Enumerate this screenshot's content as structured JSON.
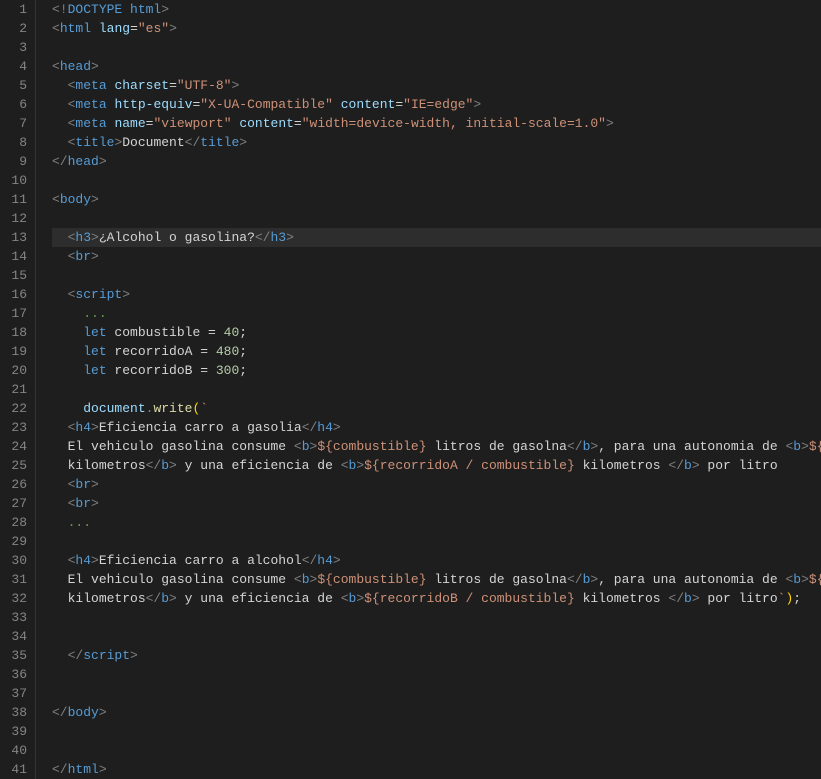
{
  "editor": {
    "background": "#1e1e1e",
    "lines": [
      {
        "num": 1,
        "tokens": [
          {
            "t": "<!",
            "c": "punct"
          },
          {
            "t": "DOCTYPE",
            "c": "kw"
          },
          {
            "t": " html",
            "c": "tag"
          },
          {
            "t": ">",
            "c": "punct"
          }
        ]
      },
      {
        "num": 2,
        "tokens": [
          {
            "t": "<",
            "c": "punct"
          },
          {
            "t": "html",
            "c": "tag"
          },
          {
            "t": " ",
            "c": "text-white"
          },
          {
            "t": "lang",
            "c": "attr"
          },
          {
            "t": "=",
            "c": "equals"
          },
          {
            "t": "\"es\"",
            "c": "str"
          },
          {
            "t": ">",
            "c": "punct"
          }
        ]
      },
      {
        "num": 3,
        "tokens": []
      },
      {
        "num": 4,
        "tokens": [
          {
            "t": "<",
            "c": "punct"
          },
          {
            "t": "head",
            "c": "tag"
          },
          {
            "t": ">",
            "c": "punct"
          }
        ]
      },
      {
        "num": 5,
        "tokens": [
          {
            "t": "  ",
            "c": "text-white"
          },
          {
            "t": "<",
            "c": "punct"
          },
          {
            "t": "meta",
            "c": "tag"
          },
          {
            "t": " ",
            "c": "text-white"
          },
          {
            "t": "charset",
            "c": "attr"
          },
          {
            "t": "=",
            "c": "equals"
          },
          {
            "t": "\"UTF-8\"",
            "c": "str"
          },
          {
            "t": ">",
            "c": "punct"
          }
        ]
      },
      {
        "num": 6,
        "tokens": [
          {
            "t": "  ",
            "c": "text-white"
          },
          {
            "t": "<",
            "c": "punct"
          },
          {
            "t": "meta",
            "c": "tag"
          },
          {
            "t": " ",
            "c": "text-white"
          },
          {
            "t": "http-equiv",
            "c": "attr"
          },
          {
            "t": "=",
            "c": "equals"
          },
          {
            "t": "\"X-UA-Compatible\"",
            "c": "str"
          },
          {
            "t": " ",
            "c": "text-white"
          },
          {
            "t": "content",
            "c": "attr"
          },
          {
            "t": "=",
            "c": "equals"
          },
          {
            "t": "\"IE=edge\"",
            "c": "str"
          },
          {
            "t": ">",
            "c": "punct"
          }
        ]
      },
      {
        "num": 7,
        "tokens": [
          {
            "t": "  ",
            "c": "text-white"
          },
          {
            "t": "<",
            "c": "punct"
          },
          {
            "t": "meta",
            "c": "tag"
          },
          {
            "t": " ",
            "c": "text-white"
          },
          {
            "t": "name",
            "c": "attr"
          },
          {
            "t": "=",
            "c": "equals"
          },
          {
            "t": "\"viewport\"",
            "c": "str"
          },
          {
            "t": " ",
            "c": "text-white"
          },
          {
            "t": "content",
            "c": "attr"
          },
          {
            "t": "=",
            "c": "equals"
          },
          {
            "t": "\"width=device-width, initial-scale=1.0\"",
            "c": "str"
          },
          {
            "t": ">",
            "c": "punct"
          }
        ]
      },
      {
        "num": 8,
        "tokens": [
          {
            "t": "  ",
            "c": "text-white"
          },
          {
            "t": "<",
            "c": "punct"
          },
          {
            "t": "title",
            "c": "tag"
          },
          {
            "t": ">",
            "c": "punct"
          },
          {
            "t": "Document",
            "c": "text-white"
          },
          {
            "t": "</",
            "c": "punct"
          },
          {
            "t": "title",
            "c": "tag"
          },
          {
            "t": ">",
            "c": "punct"
          }
        ]
      },
      {
        "num": 9,
        "tokens": [
          {
            "t": "</",
            "c": "punct"
          },
          {
            "t": "head",
            "c": "tag"
          },
          {
            "t": ">",
            "c": "punct"
          }
        ]
      },
      {
        "num": 10,
        "tokens": []
      },
      {
        "num": 11,
        "tokens": [
          {
            "t": "<",
            "c": "punct"
          },
          {
            "t": "body",
            "c": "tag"
          },
          {
            "t": ">",
            "c": "punct"
          }
        ]
      },
      {
        "num": 12,
        "tokens": []
      },
      {
        "num": 13,
        "tokens": [
          {
            "t": "  ",
            "c": "text-white"
          },
          {
            "t": "<",
            "c": "punct"
          },
          {
            "t": "h3",
            "c": "tag"
          },
          {
            "t": ">",
            "c": "punct"
          },
          {
            "t": "¿Alcohol o gasolina?",
            "c": "text-white"
          },
          {
            "t": "</",
            "c": "punct"
          },
          {
            "t": "h3",
            "c": "tag"
          },
          {
            "t": ">",
            "c": "punct"
          }
        ]
      },
      {
        "num": 14,
        "tokens": [
          {
            "t": "  ",
            "c": "text-white"
          },
          {
            "t": "<",
            "c": "punct"
          },
          {
            "t": "br",
            "c": "tag"
          },
          {
            "t": ">",
            "c": "punct"
          }
        ]
      },
      {
        "num": 15,
        "tokens": []
      },
      {
        "num": 16,
        "tokens": [
          {
            "t": "  ",
            "c": "text-white"
          },
          {
            "t": "<",
            "c": "punct"
          },
          {
            "t": "script",
            "c": "tag"
          },
          {
            "t": ">",
            "c": "punct"
          }
        ]
      },
      {
        "num": 17,
        "tokens": [
          {
            "t": "    ",
            "c": "text-white"
          },
          {
            "t": "...",
            "c": "comment"
          }
        ]
      },
      {
        "num": 18,
        "tokens": [
          {
            "t": "    ",
            "c": "text-white"
          },
          {
            "t": "let",
            "c": "kw"
          },
          {
            "t": " combustible ",
            "c": "text-white"
          },
          {
            "t": "=",
            "c": "equals"
          },
          {
            "t": " ",
            "c": "text-white"
          },
          {
            "t": "40",
            "c": "num"
          },
          {
            "t": ";",
            "c": "semi"
          }
        ]
      },
      {
        "num": 19,
        "tokens": [
          {
            "t": "    ",
            "c": "text-white"
          },
          {
            "t": "let",
            "c": "kw"
          },
          {
            "t": " recorridoA ",
            "c": "text-white"
          },
          {
            "t": "=",
            "c": "equals"
          },
          {
            "t": " ",
            "c": "text-white"
          },
          {
            "t": "480",
            "c": "num"
          },
          {
            "t": ";",
            "c": "semi"
          }
        ]
      },
      {
        "num": 20,
        "tokens": [
          {
            "t": "    ",
            "c": "text-white"
          },
          {
            "t": "let",
            "c": "kw"
          },
          {
            "t": " recorridoB ",
            "c": "text-white"
          },
          {
            "t": "=",
            "c": "equals"
          },
          {
            "t": " ",
            "c": "text-white"
          },
          {
            "t": "300",
            "c": "num"
          },
          {
            "t": ";",
            "c": "semi"
          }
        ]
      },
      {
        "num": 21,
        "tokens": []
      },
      {
        "num": 22,
        "tokens": [
          {
            "t": "    ",
            "c": "text-white"
          },
          {
            "t": "document",
            "c": "var"
          },
          {
            "t": ".",
            "c": "punct"
          },
          {
            "t": "write",
            "c": "fn"
          },
          {
            "t": "(",
            "c": "bracket"
          },
          {
            "t": "`",
            "c": "template"
          }
        ]
      },
      {
        "num": 23,
        "tokens": [
          {
            "t": "  ",
            "c": "text-white"
          },
          {
            "t": "<",
            "c": "punct"
          },
          {
            "t": "h4",
            "c": "tag"
          },
          {
            "t": ">",
            "c": "punct"
          },
          {
            "t": "Eficiencia carro a gasolia",
            "c": "text-white"
          },
          {
            "t": "</",
            "c": "punct"
          },
          {
            "t": "h4",
            "c": "tag"
          },
          {
            "t": ">",
            "c": "punct"
          }
        ]
      },
      {
        "num": 24,
        "tokens": [
          {
            "t": "  ",
            "c": "text-white"
          },
          {
            "t": "El vehiculo ",
            "c": "text-white"
          },
          {
            "t": "gasolina",
            "c": "text-white"
          },
          {
            "t": " consume ",
            "c": "text-white"
          },
          {
            "t": "<",
            "c": "punct"
          },
          {
            "t": "b",
            "c": "tag"
          },
          {
            "t": ">",
            "c": "punct"
          },
          {
            "t": "${combustible}",
            "c": "template"
          },
          {
            "t": " litros de gasolna",
            "c": "text-white"
          },
          {
            "t": "</",
            "c": "punct"
          },
          {
            "t": "b",
            "c": "tag"
          },
          {
            "t": ">",
            "c": "punct"
          },
          {
            "t": ", para una autonomia de ",
            "c": "text-white"
          },
          {
            "t": "<",
            "c": "punct"
          },
          {
            "t": "b",
            "c": "tag"
          },
          {
            "t": ">",
            "c": "punct"
          },
          {
            "t": "${recorridoA}",
            "c": "template"
          }
        ]
      },
      {
        "num": 25,
        "tokens": [
          {
            "t": "  ",
            "c": "text-white"
          },
          {
            "t": "kilometros",
            "c": "text-white"
          },
          {
            "t": "</",
            "c": "punct"
          },
          {
            "t": "b",
            "c": "tag"
          },
          {
            "t": ">",
            "c": "punct"
          },
          {
            "t": " y una eficiencia de ",
            "c": "text-white"
          },
          {
            "t": "<",
            "c": "punct"
          },
          {
            "t": "b",
            "c": "tag"
          },
          {
            "t": ">",
            "c": "punct"
          },
          {
            "t": "${recorridoA / combustible}",
            "c": "template"
          },
          {
            "t": " kilometros ",
            "c": "text-white"
          },
          {
            "t": "</",
            "c": "punct"
          },
          {
            "t": "b",
            "c": "tag"
          },
          {
            "t": ">",
            "c": "punct"
          },
          {
            "t": " por litro",
            "c": "text-white"
          }
        ]
      },
      {
        "num": 26,
        "tokens": [
          {
            "t": "  ",
            "c": "text-white"
          },
          {
            "t": "<",
            "c": "punct"
          },
          {
            "t": "br",
            "c": "tag"
          },
          {
            "t": ">",
            "c": "punct"
          }
        ]
      },
      {
        "num": 27,
        "tokens": [
          {
            "t": "  ",
            "c": "text-white"
          },
          {
            "t": "<",
            "c": "punct"
          },
          {
            "t": "br",
            "c": "tag"
          },
          {
            "t": ">",
            "c": "punct"
          }
        ]
      },
      {
        "num": 28,
        "tokens": [
          {
            "t": "  ",
            "c": "text-white"
          },
          {
            "t": "...",
            "c": "comment"
          }
        ]
      },
      {
        "num": 29,
        "tokens": []
      },
      {
        "num": 30,
        "tokens": [
          {
            "t": "  ",
            "c": "text-white"
          },
          {
            "t": "<",
            "c": "punct"
          },
          {
            "t": "h4",
            "c": "tag"
          },
          {
            "t": ">",
            "c": "punct"
          },
          {
            "t": "Eficiencia carro a alcohol",
            "c": "text-white"
          },
          {
            "t": "</",
            "c": "punct"
          },
          {
            "t": "h4",
            "c": "tag"
          },
          {
            "t": ">",
            "c": "punct"
          }
        ]
      },
      {
        "num": 31,
        "tokens": [
          {
            "t": "  ",
            "c": "text-white"
          },
          {
            "t": "El vehiculo ",
            "c": "text-white"
          },
          {
            "t": "gasolina",
            "c": "text-white"
          },
          {
            "t": " consume ",
            "c": "text-white"
          },
          {
            "t": "<",
            "c": "punct"
          },
          {
            "t": "b",
            "c": "tag"
          },
          {
            "t": ">",
            "c": "punct"
          },
          {
            "t": "${combustible}",
            "c": "template"
          },
          {
            "t": " litros de gasolna",
            "c": "text-white"
          },
          {
            "t": "</",
            "c": "punct"
          },
          {
            "t": "b",
            "c": "tag"
          },
          {
            "t": ">",
            "c": "punct"
          },
          {
            "t": ", para una autonomia de ",
            "c": "text-white"
          },
          {
            "t": "<",
            "c": "punct"
          },
          {
            "t": "b",
            "c": "tag"
          },
          {
            "t": ">",
            "c": "punct"
          },
          {
            "t": "${recorridoB}",
            "c": "template"
          }
        ]
      },
      {
        "num": 32,
        "tokens": [
          {
            "t": "  ",
            "c": "text-white"
          },
          {
            "t": "kilometros",
            "c": "text-white"
          },
          {
            "t": "</",
            "c": "punct"
          },
          {
            "t": "b",
            "c": "tag"
          },
          {
            "t": ">",
            "c": "punct"
          },
          {
            "t": " y una eficiencia de ",
            "c": "text-white"
          },
          {
            "t": "<",
            "c": "punct"
          },
          {
            "t": "b",
            "c": "tag"
          },
          {
            "t": ">",
            "c": "punct"
          },
          {
            "t": "${recorridoB / combustible}",
            "c": "template"
          },
          {
            "t": " kilometros ",
            "c": "text-white"
          },
          {
            "t": "</",
            "c": "punct"
          },
          {
            "t": "b",
            "c": "tag"
          },
          {
            "t": ">",
            "c": "punct"
          },
          {
            "t": " por litro",
            "c": "text-white"
          },
          {
            "t": "`",
            "c": "template"
          },
          {
            "t": ")",
            "c": "bracket"
          },
          {
            "t": ";",
            "c": "semi"
          }
        ]
      },
      {
        "num": 33,
        "tokens": []
      },
      {
        "num": 34,
        "tokens": []
      },
      {
        "num": 35,
        "tokens": [
          {
            "t": "  ",
            "c": "text-white"
          },
          {
            "t": "</",
            "c": "punct"
          },
          {
            "t": "script",
            "c": "tag"
          },
          {
            "t": ">",
            "c": "punct"
          }
        ]
      },
      {
        "num": 36,
        "tokens": []
      },
      {
        "num": 37,
        "tokens": []
      },
      {
        "num": 38,
        "tokens": [
          {
            "t": "</",
            "c": "punct"
          },
          {
            "t": "body",
            "c": "tag"
          },
          {
            "t": ">",
            "c": "punct"
          }
        ]
      },
      {
        "num": 39,
        "tokens": []
      },
      {
        "num": 40,
        "tokens": []
      },
      {
        "num": 41,
        "tokens": [
          {
            "t": "</",
            "c": "punct"
          },
          {
            "t": "html",
            "c": "tag"
          },
          {
            "t": ">",
            "c": "punct"
          }
        ]
      }
    ]
  }
}
